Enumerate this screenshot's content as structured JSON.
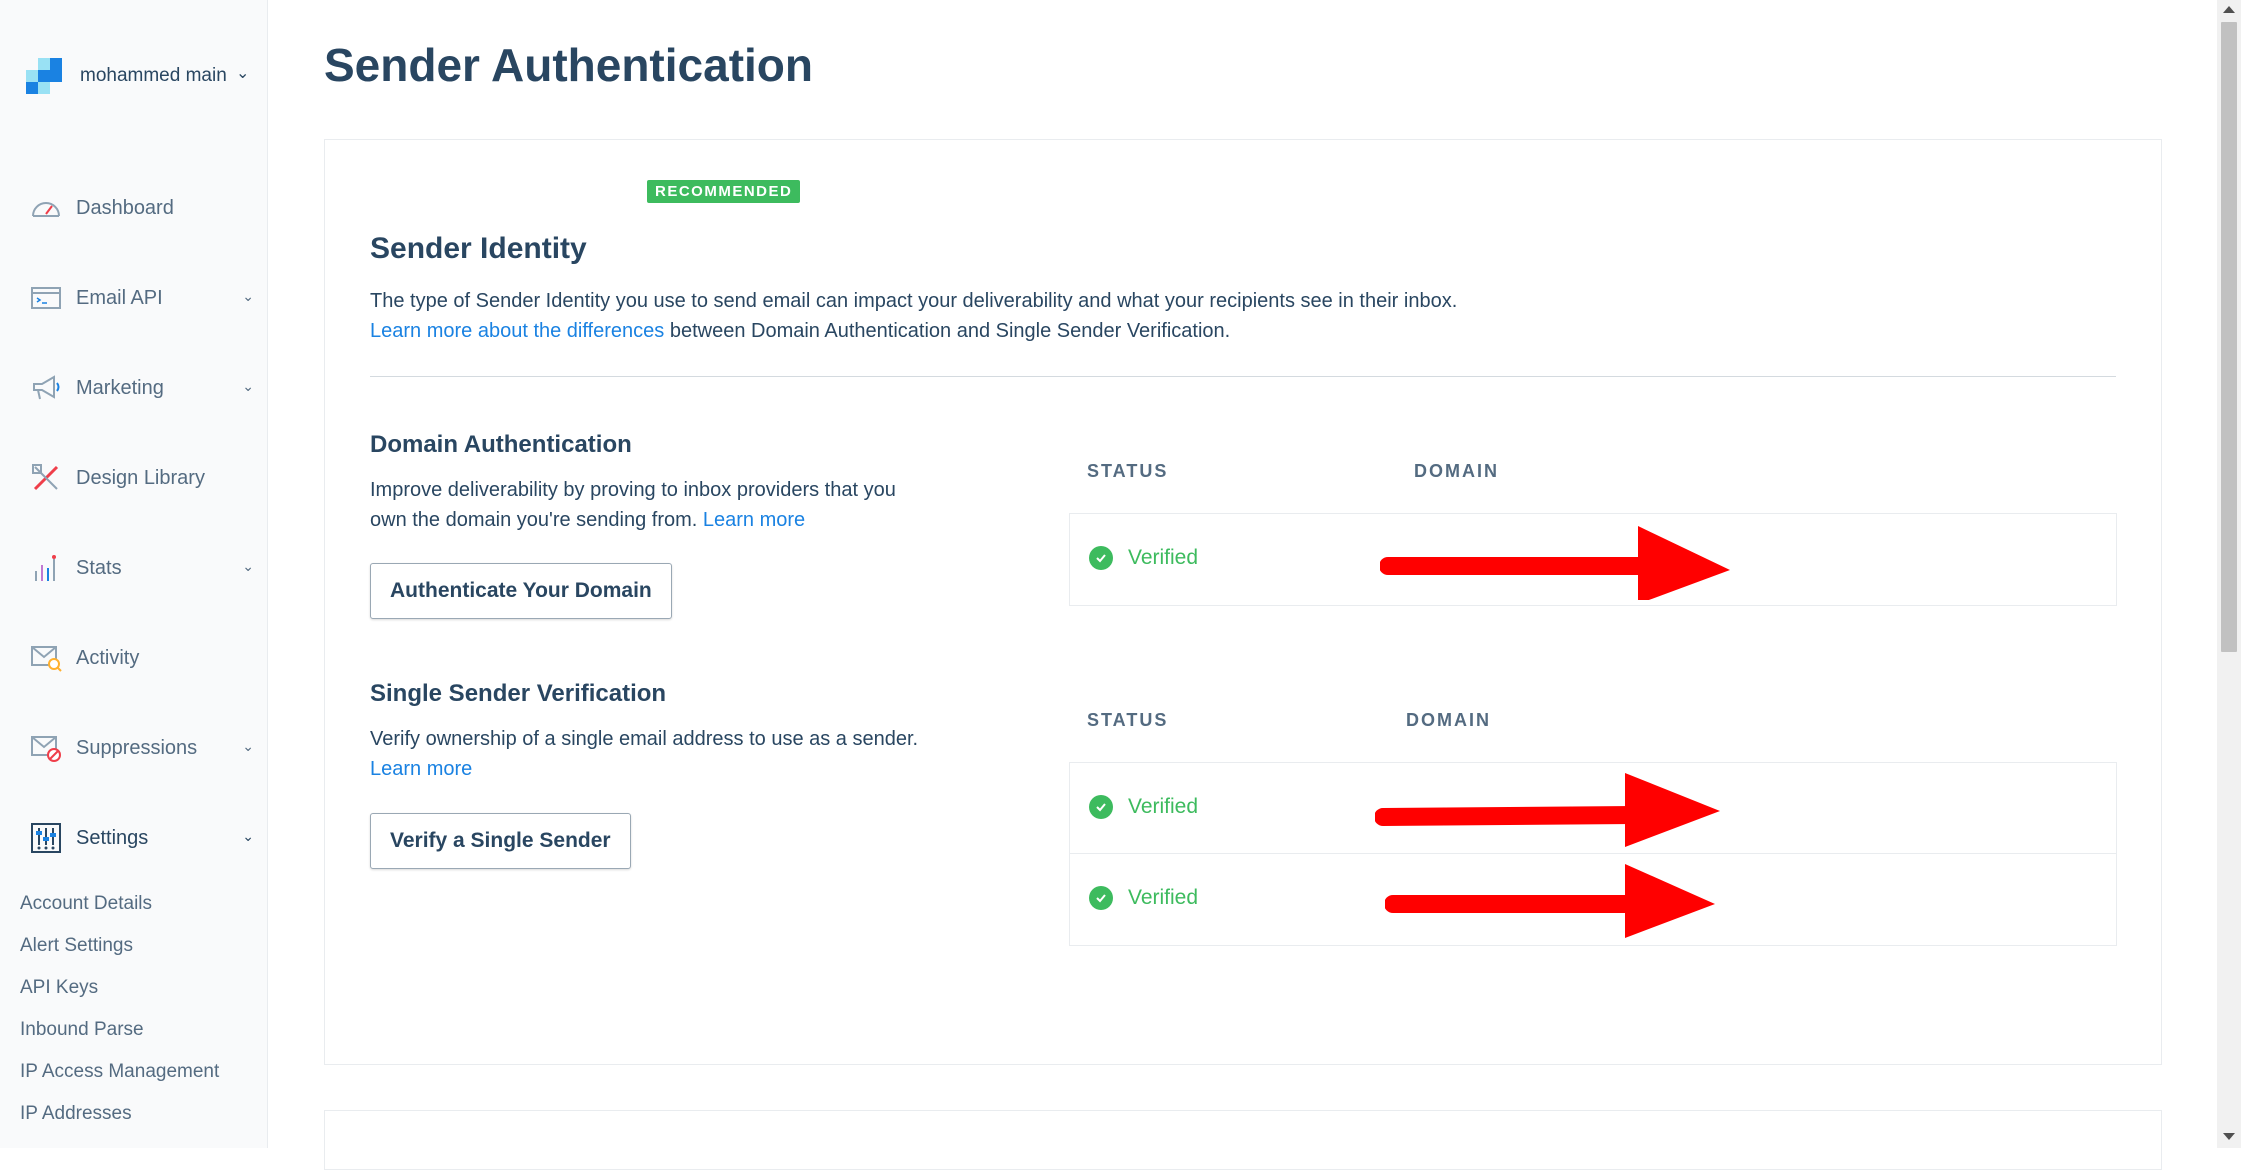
{
  "sidebar": {
    "account_name": "mohammed main",
    "nav": [
      {
        "label": "Dashboard",
        "icon": "dashboard-icon"
      },
      {
        "label": "Email API",
        "icon": "email-api-icon"
      },
      {
        "label": "Marketing",
        "icon": "megaphone-icon"
      },
      {
        "label": "Design Library",
        "icon": "design-library-icon"
      },
      {
        "label": "Stats",
        "icon": "stats-icon"
      },
      {
        "label": "Activity",
        "icon": "activity-icon"
      },
      {
        "label": "Suppressions",
        "icon": "suppressions-icon"
      },
      {
        "label": "Settings",
        "icon": "settings-icon"
      }
    ],
    "settings_sub": [
      "Account Details",
      "Alert Settings",
      "API Keys",
      "Inbound Parse",
      "IP Access Management",
      "IP Addresses"
    ]
  },
  "page": {
    "title": "Sender Authentication"
  },
  "sender_identity": {
    "badge": "RECOMMENDED",
    "title": "Sender Identity",
    "description": "The type of Sender Identity you use to send email can impact your deliverability and what your recipients see in their inbox.",
    "learn_link": "Learn more about the differences",
    "learn_suffix": " between Domain Authentication and Single Sender Verification."
  },
  "domain_auth": {
    "title": "Domain Authentication",
    "desc_line1": "Improve deliverability by proving to inbox providers that you",
    "desc_line2": "own the domain you're sending from. ",
    "learn_more": "Learn more",
    "button": "Authenticate Your Domain",
    "col_status": "STATUS",
    "col_domain": "DOMAIN",
    "rows": [
      {
        "status": "Verified"
      }
    ]
  },
  "single_sender": {
    "title": "Single Sender Verification",
    "desc": "Verify ownership of a single email address to use as a sender.",
    "learn_more": "Learn more",
    "button": "Verify a Single Sender",
    "col_status": "STATUS",
    "col_domain": "DOMAIN",
    "rows": [
      {
        "status": "Verified"
      },
      {
        "status": "Verified"
      }
    ]
  },
  "colors": {
    "primary_text": "#294661",
    "link": "#1a82e2",
    "verified_green": "#3dbb5e",
    "annotation_arrow": "#ff0000"
  }
}
